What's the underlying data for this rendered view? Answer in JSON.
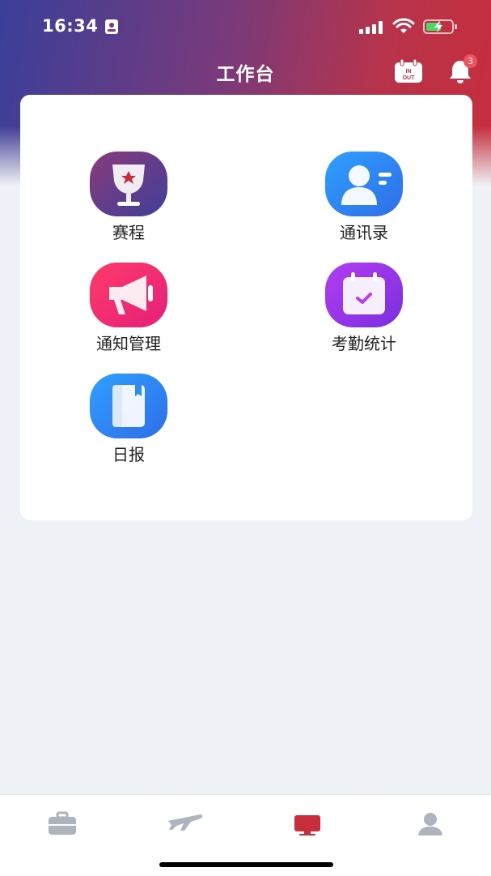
{
  "status_bar": {
    "time": "16:34"
  },
  "header": {
    "title": "工作台",
    "inout_icon_text_top": "IN",
    "inout_icon_text_bottom": "OUT",
    "notification_count": "3"
  },
  "tiles": [
    {
      "label": "赛程",
      "icon": "trophy-icon"
    },
    {
      "label": "通讯录",
      "icon": "contact-icon"
    },
    {
      "label": "通知管理",
      "icon": "megaphone-icon"
    },
    {
      "label": "考勤统计",
      "icon": "calendar-check-icon"
    },
    {
      "label": "日报",
      "icon": "book-icon"
    }
  ],
  "tabbar": {
    "tabs": [
      {
        "icon": "briefcase-icon",
        "active": false
      },
      {
        "icon": "airplane-icon",
        "active": false
      },
      {
        "icon": "monitor-icon",
        "active": true
      },
      {
        "icon": "person-icon",
        "active": false
      }
    ]
  },
  "colors": {
    "accent": "#c72d3b",
    "tab_inactive": "#aeb4bd"
  }
}
